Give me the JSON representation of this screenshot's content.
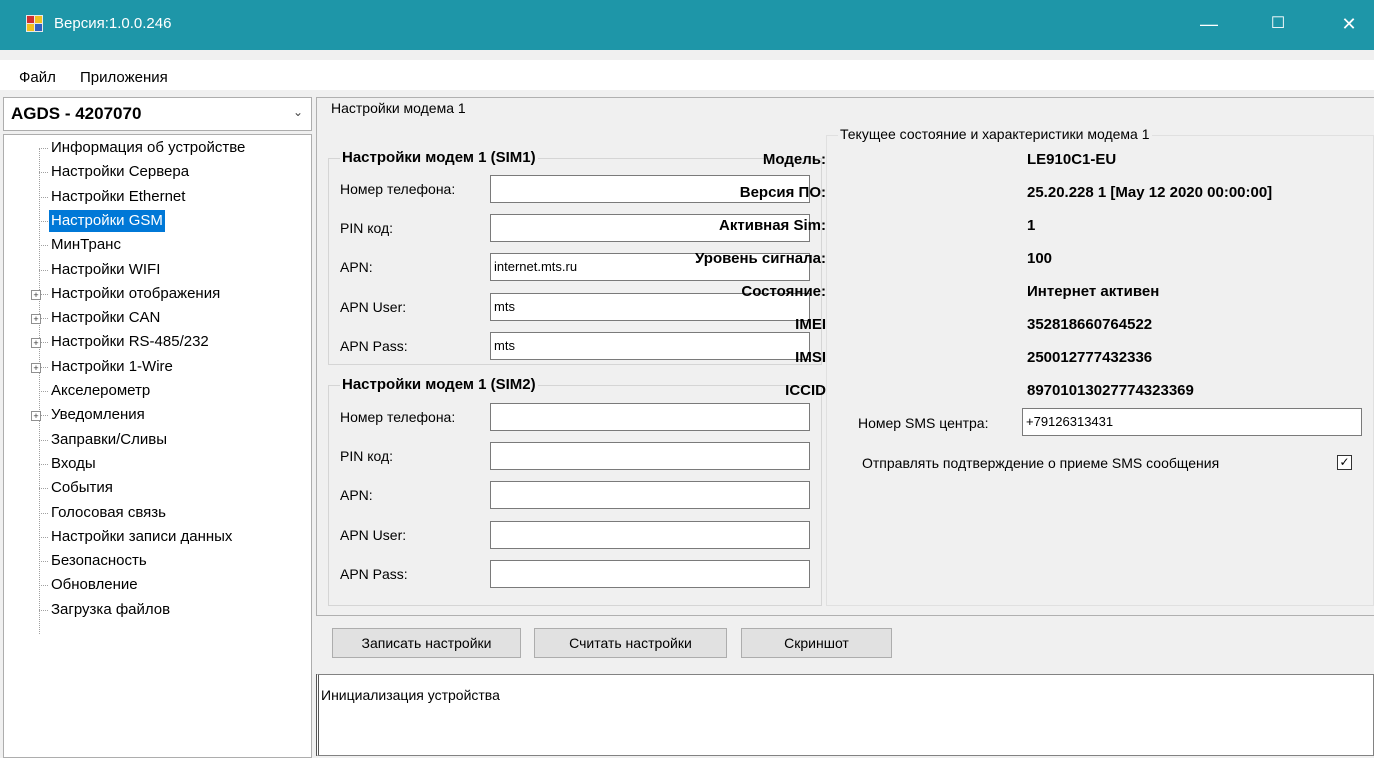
{
  "window": {
    "title": "Версия:1.0.0.246",
    "controls": {
      "minimize": "—",
      "maximize": "☐",
      "close": "✕"
    }
  },
  "menu": {
    "items": [
      "Файл",
      "Приложения"
    ]
  },
  "device_select": {
    "value": "AGDS - 4207070"
  },
  "tree": {
    "items": [
      {
        "label": "Информация об устройстве",
        "expandable": false
      },
      {
        "label": "Настройки Сервера",
        "expandable": false
      },
      {
        "label": "Настройки Ethernet",
        "expandable": false
      },
      {
        "label": "Настройки GSM",
        "expandable": false,
        "selected": true
      },
      {
        "label": "МинТранс",
        "expandable": false
      },
      {
        "label": "Настройки WIFI",
        "expandable": false
      },
      {
        "label": "Настройки отображения",
        "expandable": true
      },
      {
        "label": "Настройки CAN",
        "expandable": true
      },
      {
        "label": "Настройки RS-485/232",
        "expandable": true
      },
      {
        "label": "Настройки 1-Wire",
        "expandable": true
      },
      {
        "label": "Акселерометр",
        "expandable": false
      },
      {
        "label": "Уведомления",
        "expandable": true
      },
      {
        "label": "Заправки/Сливы",
        "expandable": false
      },
      {
        "label": "Входы",
        "expandable": false
      },
      {
        "label": "События",
        "expandable": false
      },
      {
        "label": "Голосовая связь",
        "expandable": false
      },
      {
        "label": "Настройки записи данных",
        "expandable": false
      },
      {
        "label": "Безопасность",
        "expandable": false
      },
      {
        "label": "Обновление",
        "expandable": false
      },
      {
        "label": "Загрузка файлов",
        "expandable": false
      }
    ]
  },
  "modem": {
    "group_title": "Настройки модема 1",
    "sim1": {
      "title": "Настройки модем 1 (SIM1)",
      "fields": [
        {
          "label": "Номер телефона:",
          "value": ""
        },
        {
          "label": "PIN код:",
          "value": ""
        },
        {
          "label": "APN:",
          "value": "internet.mts.ru"
        },
        {
          "label": "APN User:",
          "value": "mts"
        },
        {
          "label": "APN Pass:",
          "value": "mts"
        }
      ]
    },
    "sim2": {
      "title": "Настройки модем 1 (SIM2)",
      "fields": [
        {
          "label": "Номер телефона:",
          "value": ""
        },
        {
          "label": "PIN код:",
          "value": ""
        },
        {
          "label": "APN:",
          "value": ""
        },
        {
          "label": "APN User:",
          "value": ""
        },
        {
          "label": "APN Pass:",
          "value": ""
        }
      ]
    },
    "status": {
      "title": "Текущее состояние и характеристики модема 1",
      "rows": [
        {
          "label": "Модель:",
          "value": "LE910C1-EU"
        },
        {
          "label": "Версия ПО:",
          "value": "25.20.228  1  [May 12 2020 00:00:00]"
        },
        {
          "label": "Активная Sim:",
          "value": "1"
        },
        {
          "label": "Уровень сигнала:",
          "value": "100"
        },
        {
          "label": "Состояние:",
          "value": "Интернет активен"
        },
        {
          "label": "IMEI",
          "value": "352818660764522"
        },
        {
          "label": "IMSI",
          "value": "250012777432336"
        },
        {
          "label": "ICCID",
          "value": "89701013027774323369"
        }
      ],
      "sms_center_label": "Номер SMS центра:",
      "sms_center_value": "+79126313431",
      "sms_confirm_label": "Отправлять подтверждение о приеме SMS сообщения",
      "sms_confirm_checked": true
    }
  },
  "buttons": {
    "write": "Записать настройки",
    "read": "Считать настройки",
    "screenshot": "Скриншот"
  },
  "log": {
    "text": "Инициализация устройства"
  }
}
